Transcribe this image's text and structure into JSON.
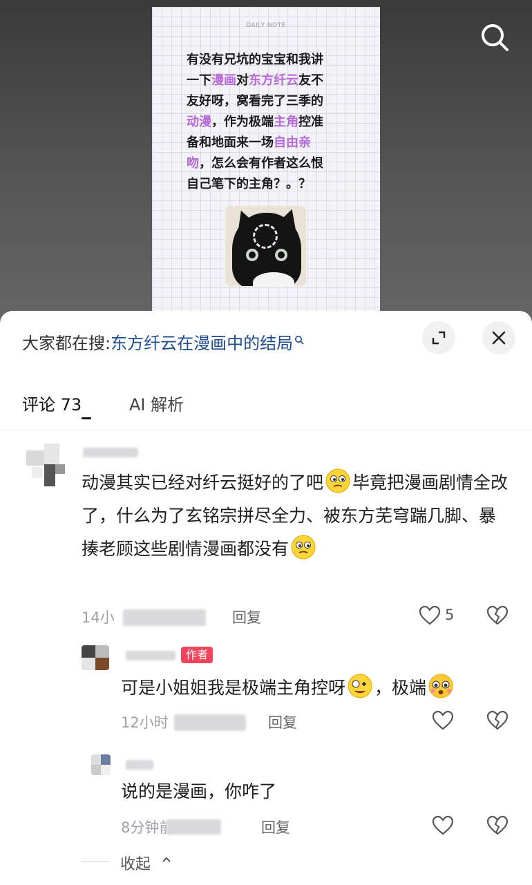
{
  "note": {
    "header": "DAILY NOTE",
    "lines": [
      [
        {
          "t": "有没有兄坑的宝宝和我讲",
          "h": false
        }
      ],
      [
        {
          "t": "一下",
          "h": false
        },
        {
          "t": "漫画",
          "h": true
        },
        {
          "t": "对",
          "h": false
        },
        {
          "t": "东方纤云",
          "h": true
        },
        {
          "t": "友不",
          "h": false
        }
      ],
      [
        {
          "t": "友好呀，窝看完了三季的",
          "h": false
        }
      ],
      [
        {
          "t": "动漫",
          "h": true
        },
        {
          "t": "，作为极端",
          "h": false
        },
        {
          "t": "主角",
          "h": true
        },
        {
          "t": "控准",
          "h": false
        }
      ],
      [
        {
          "t": "备和地面来一场",
          "h": false
        },
        {
          "t": "自由亲",
          "h": true
        }
      ],
      [
        {
          "t": "吻",
          "h": true
        },
        {
          "t": "，怎么会有作者这么恨",
          "h": false
        }
      ],
      [
        {
          "t": "自己笔下的主角？。？",
          "h": false
        }
      ]
    ]
  },
  "search": {
    "prefix": "大家都在搜:",
    "term": "东方纤云在漫画中的结局"
  },
  "tabs": {
    "comments": "评论 73",
    "ai": "AI 解析"
  },
  "comments": [
    {
      "text_before": "动漫其实已经对纤云挺好的了吧",
      "text_mid": "毕竟把漫画剧情全改了，什么为了玄铭宗拼尽全力、被东方芜穹踹几脚、暴揍老顾这些剧情漫画都没有",
      "time": "14小",
      "reply": "回复",
      "likes": "5"
    },
    {
      "badge": "作者",
      "text_before": "可是小姐姐我是极端主角控呀",
      "text_mid": "，极端",
      "time": "12小时",
      "reply": "回复"
    },
    {
      "text": "说的是漫画，你咋了",
      "time": "8分钟前",
      "reply": "回复"
    }
  ],
  "collapse_label": "收起",
  "colors": {
    "highlight": "#b56ad8",
    "search_term": "#1e4c8f",
    "author_badge": "#f3445e"
  },
  "icons": [
    "search-icon",
    "expand-icon",
    "close-icon",
    "heart-icon",
    "broken-heart-icon",
    "chevron-up-icon",
    "emoji-icon"
  ]
}
